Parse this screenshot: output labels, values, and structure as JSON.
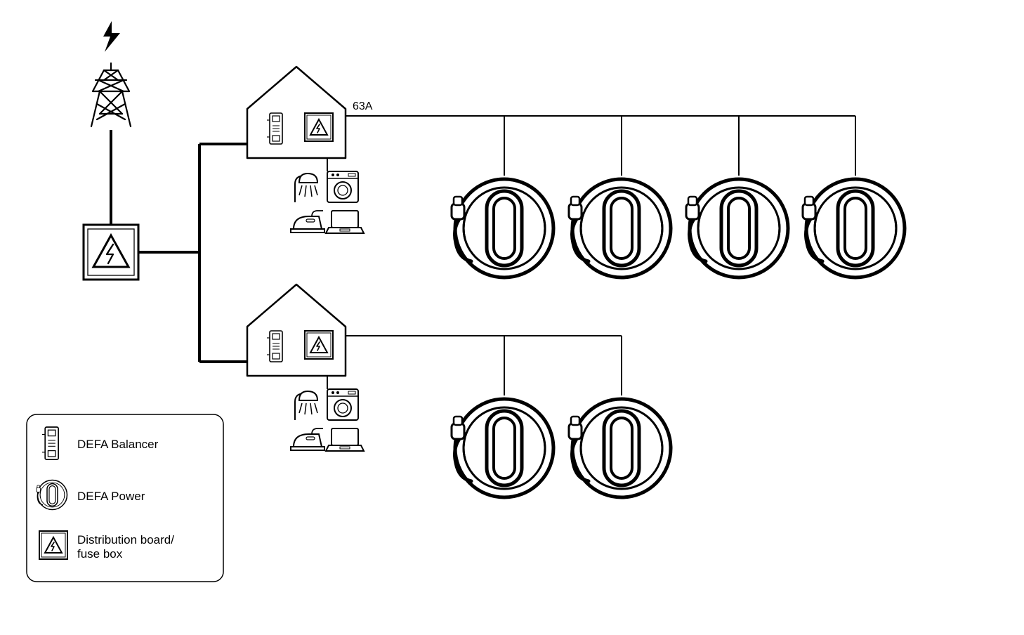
{
  "bus_label": "63A",
  "legend": {
    "balancer": "DEFA Balancer",
    "power": "DEFA Power",
    "dist1": "Distribution board/",
    "dist2": "fuse box"
  },
  "icons": {
    "lightning": "lightning-icon",
    "tower": "power-tower-icon",
    "distboard": "distribution-board-icon",
    "house": "house-icon",
    "balancer": "defa-balancer-icon",
    "shower": "shower-icon",
    "washer": "washing-machine-icon",
    "iron": "iron-icon",
    "laptop": "laptop-icon",
    "charger": "defa-power-charger-icon"
  }
}
